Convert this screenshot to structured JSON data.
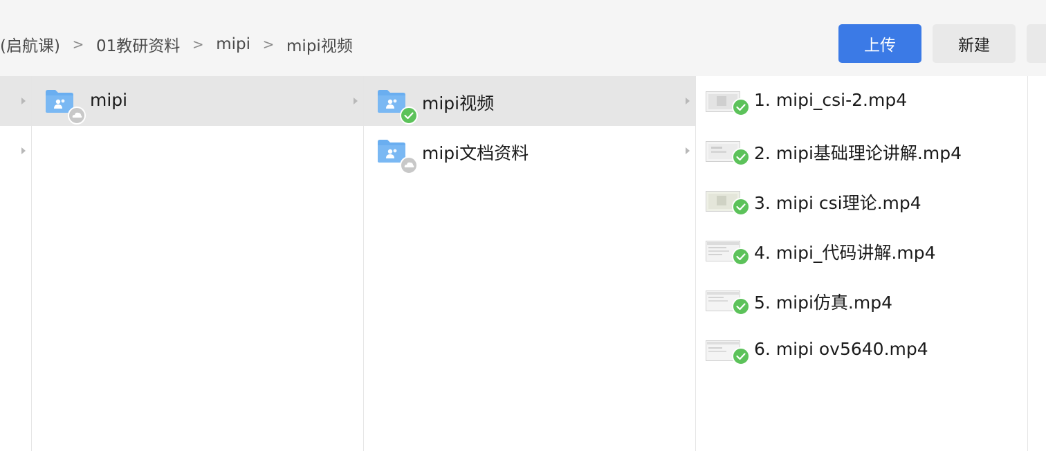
{
  "breadcrumb": {
    "items": [
      "(启航课)",
      "01教研资料",
      "mipi",
      "mipi视频"
    ],
    "separator": ">"
  },
  "toolbar": {
    "upload_label": "上传",
    "new_label": "新建"
  },
  "colors": {
    "accent": "#3b7ae6",
    "selected_row": "#e6e6e6",
    "folder_blue": "#6aaef0",
    "sync_green": "#5cc25a",
    "cloud_gray": "#c8c8c8"
  },
  "column1": {
    "items": [
      {
        "label": "mipi",
        "icon": "shared-folder-icon",
        "status": "cloud-icon",
        "selected": true
      }
    ]
  },
  "column2": {
    "items": [
      {
        "label": "mipi视频",
        "icon": "shared-folder-icon",
        "status": "synced-check-icon",
        "selected": true
      },
      {
        "label": "mipi文档资料",
        "icon": "shared-folder-icon",
        "status": "cloud-icon",
        "selected": false
      }
    ]
  },
  "column3": {
    "items": [
      {
        "label": "1. mipi_csi-2.mp4",
        "icon": "video-thumbnail-icon",
        "status": "synced-check-icon"
      },
      {
        "label": "2. mipi基础理论讲解.mp4",
        "icon": "video-thumbnail-icon",
        "status": "synced-check-icon"
      },
      {
        "label": "3. mipi csi理论.mp4",
        "icon": "video-thumbnail-icon",
        "status": "synced-check-icon"
      },
      {
        "label": "4. mipi_代码讲解.mp4",
        "icon": "video-thumbnail-icon",
        "status": "synced-check-icon"
      },
      {
        "label": "5. mipi仿真.mp4",
        "icon": "video-thumbnail-icon",
        "status": "synced-check-icon"
      },
      {
        "label": "6. mipi ov5640.mp4",
        "icon": "video-thumbnail-icon",
        "status": "synced-check-icon"
      }
    ]
  }
}
